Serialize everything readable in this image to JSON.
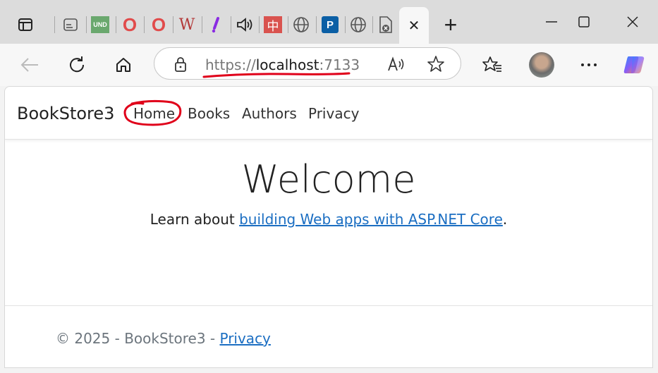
{
  "tabs": [
    {
      "icon": "sidebar-icon"
    },
    {
      "icon": "page-icon"
    },
    {
      "icon": "und-favicon",
      "text": "UND"
    },
    {
      "icon": "opera-icon",
      "text": "O"
    },
    {
      "icon": "opera-icon",
      "text": "O"
    },
    {
      "icon": "w-favicon",
      "text": "W"
    },
    {
      "icon": "slash-favicon"
    },
    {
      "icon": "speaker-icon"
    },
    {
      "icon": "zh-favicon",
      "text": "中"
    },
    {
      "icon": "globe-icon"
    },
    {
      "icon": "p-favicon",
      "text": "P"
    },
    {
      "icon": "globe-icon"
    },
    {
      "icon": "error-page-icon"
    }
  ],
  "active_tab": {
    "close": "✕"
  },
  "new_tab": "+",
  "address": {
    "scheme": "https://",
    "host": "localhost",
    "port": ":7133"
  },
  "site": {
    "brand": "BookStore3",
    "nav": [
      "Home",
      "Books",
      "Authors",
      "Privacy"
    ],
    "heading": "Welcome",
    "lead_prefix": "Learn about ",
    "lead_link": "building Web apps with ASP.NET Core",
    "lead_suffix": ".",
    "footer_text": "© 2025 - BookStore3 - ",
    "footer_link": "Privacy"
  },
  "colors": {
    "link": "#1b6ec2",
    "annotation": "#e0001a"
  }
}
